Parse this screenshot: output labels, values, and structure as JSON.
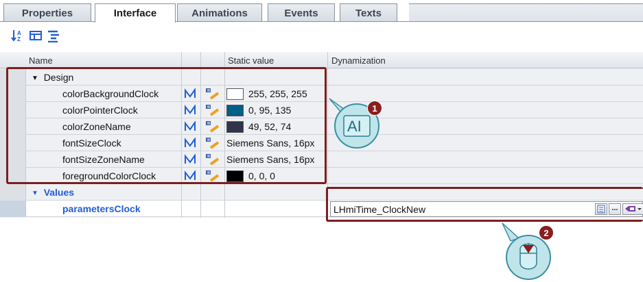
{
  "tabs": [
    {
      "label": "Properties",
      "active": false
    },
    {
      "label": "Interface",
      "active": true
    },
    {
      "label": "Animations",
      "active": false
    },
    {
      "label": "Events",
      "active": false
    },
    {
      "label": "Texts",
      "active": false
    }
  ],
  "toolbar": {
    "icons": [
      "sort-icon",
      "group-icon",
      "tree-list-icon"
    ]
  },
  "grid": {
    "columns": {
      "name": "Name",
      "static_value": "Static value",
      "dynamization": "Dynamization"
    },
    "groups": [
      {
        "label": "Design",
        "rows": [
          {
            "name": "colorBackgroundClock",
            "value": "255, 255, 255",
            "swatch": "#ffffff"
          },
          {
            "name": "colorPointerClock",
            "value": "0, 95, 135",
            "swatch": "#005f87"
          },
          {
            "name": "colorZoneName",
            "value": "49, 52, 74",
            "swatch": "#31344a"
          },
          {
            "name": "fontSizeClock",
            "value": "Siemens Sans, 16px"
          },
          {
            "name": "fontSizeZoneName",
            "value": "Siemens Sans, 16px"
          },
          {
            "name": "foregroundColorClock",
            "value": "0, 0, 0",
            "swatch": "#000000"
          }
        ]
      },
      {
        "label": "Values",
        "rows": [
          {
            "name": "parametersClock",
            "dynamization": "LHmiTime_ClockNew"
          }
        ]
      }
    ]
  },
  "callouts": [
    {
      "number": "1",
      "icon": "text-cursor-icon",
      "text": "AI"
    },
    {
      "number": "2",
      "icon": "mouse-click-icon"
    }
  ],
  "colors": {
    "highlight": "#7a1f1f",
    "badge": "#8a1e1e",
    "callout_fill": "#bfe4ea",
    "values_text": "#1f5ed6"
  }
}
